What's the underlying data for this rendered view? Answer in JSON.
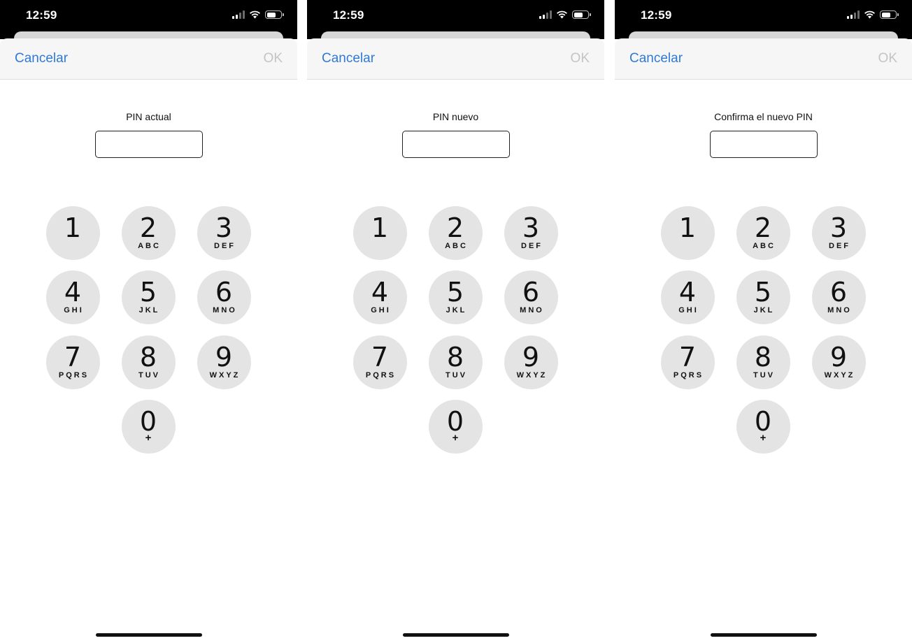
{
  "screens": [
    {
      "status": {
        "time": "12:59"
      },
      "nav": {
        "cancel_label": "Cancelar",
        "ok_label": "OK"
      },
      "pin_label": "PIN actual",
      "pin_value": ""
    },
    {
      "status": {
        "time": "12:59"
      },
      "nav": {
        "cancel_label": "Cancelar",
        "ok_label": "OK"
      },
      "pin_label": "PIN nuevo",
      "pin_value": ""
    },
    {
      "status": {
        "time": "12:59"
      },
      "nav": {
        "cancel_label": "Cancelar",
        "ok_label": "OK"
      },
      "pin_label": "Confirma el nuevo PIN",
      "pin_value": ""
    }
  ],
  "keypad": [
    {
      "digit": "1",
      "letters": ""
    },
    {
      "digit": "2",
      "letters": "ABC"
    },
    {
      "digit": "3",
      "letters": "DEF"
    },
    {
      "digit": "4",
      "letters": "GHI"
    },
    {
      "digit": "5",
      "letters": "JKL"
    },
    {
      "digit": "6",
      "letters": "MNO"
    },
    {
      "digit": "7",
      "letters": "PQRS"
    },
    {
      "digit": "8",
      "letters": "TUV"
    },
    {
      "digit": "9",
      "letters": "WXYZ"
    },
    {
      "digit": "0",
      "letters": "+"
    }
  ],
  "icons": {
    "signal": "cellular-signal-icon",
    "wifi": "wifi-icon",
    "battery": "battery-icon"
  },
  "colors": {
    "accent": "#2f7ad6",
    "ok_disabled": "#c4c4c4",
    "key_background": "#e4e4e4",
    "statusbar": "#000000"
  },
  "battery_level": 0.55
}
